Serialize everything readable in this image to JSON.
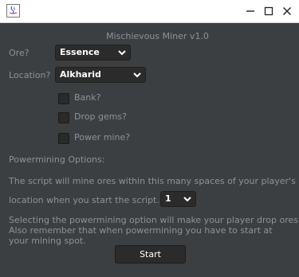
{
  "window": {
    "minimize_glyph": "—",
    "maximize_glyph": "☐",
    "close_glyph": "✕"
  },
  "app": {
    "title": "Mischievous Miner v1.0"
  },
  "form": {
    "ores_label": "Ore?",
    "ores_value": "Essence",
    "location_label": "Location?",
    "location_value": "Alkharid",
    "bank_label": "Bank?",
    "drop_gems_label": "Drop gems?",
    "power_mine_label": "Power mine?",
    "powermining_header": "Powermining Options:",
    "spaces_text_line1": "The script will mine ores within this many spaces of your player's",
    "spaces_text_line2": "location when you start the script.",
    "spaces_value": "1",
    "note_line1": "Selecting the powermining option will make your player drop ores.",
    "note_line2": "Also remember that when powermining you have to start at",
    "note_line3": "your mining spot.",
    "start_label": "Start"
  },
  "colors": {
    "background": "#3c3f41",
    "text": "#8e9297",
    "control_bg": "#2b2b2b",
    "control_text": "#ffffff"
  }
}
